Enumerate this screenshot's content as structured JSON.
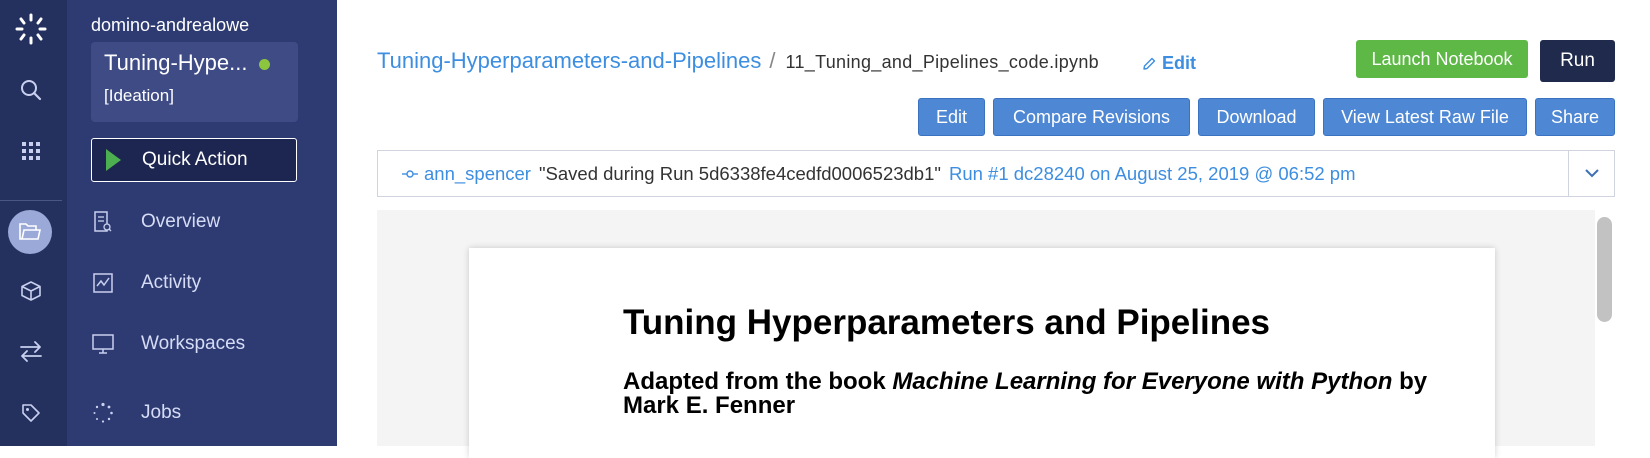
{
  "rail": {
    "icons": [
      "domino-logo-icon",
      "search-icon",
      "apps-grid-icon",
      "folder-icon",
      "cube-icon",
      "transfer-icon",
      "tag-icon"
    ]
  },
  "sidebar": {
    "org": "domino-andrealowe",
    "project_name": "Tuning-Hype...",
    "project_stage": "[Ideation]",
    "quick_action": "Quick Action",
    "items": [
      {
        "label": "Overview",
        "icon": "overview-icon"
      },
      {
        "label": "Activity",
        "icon": "activity-icon"
      },
      {
        "label": "Workspaces",
        "icon": "monitor-icon"
      },
      {
        "label": "Jobs",
        "icon": "jobs-spinner-icon"
      }
    ]
  },
  "header": {
    "project_link": "Tuning-Hyperparameters-and-Pipelines",
    "separator": "/",
    "file_name": "11_Tuning_and_Pipelines_code.ipynb",
    "edit_link": "Edit",
    "launch_notebook": "Launch Notebook",
    "run": "Run"
  },
  "toolbar": {
    "edit": "Edit",
    "compare_revisions": "Compare Revisions",
    "download": "Download",
    "view_latest_raw_file": "View Latest Raw File",
    "share": "Share"
  },
  "commit": {
    "author": "ann_spencer",
    "message": "\"Saved during Run 5d6338fe4cedfd0006523db1\"",
    "run_info": "Run #1 dc28240 on August 25, 2019 @ 06:52 pm"
  },
  "notebook": {
    "title": "Tuning Hyperparameters and Pipelines",
    "subtitle_prefix": "Adapted from the book ",
    "subtitle_book": "Machine Learning for Everyone with Python",
    "subtitle_suffix": " by Mark E. Fenner"
  },
  "colors": {
    "rail_bg": "#24305e",
    "sidebar_bg": "#2e3b72",
    "link_blue": "#3d8ee0",
    "launch_green": "#5db846",
    "run_dark": "#1f2a4d",
    "button_blue": "#4e87d4"
  }
}
